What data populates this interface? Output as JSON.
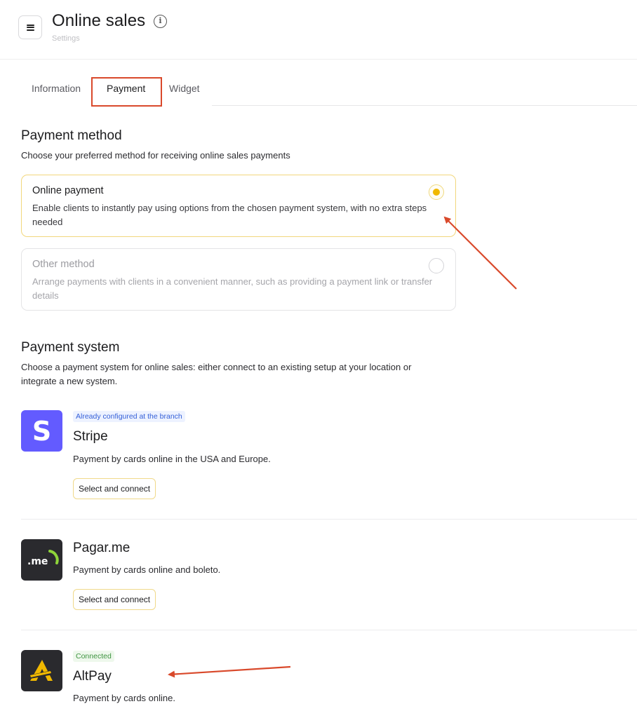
{
  "header": {
    "title": "Online sales",
    "subtitle": "Settings",
    "menu_icon": "menu-icon",
    "info_icon": "info-icon"
  },
  "tabs": [
    {
      "label": "Information",
      "active": false
    },
    {
      "label": "Payment",
      "active": true
    },
    {
      "label": "Widget",
      "active": false
    }
  ],
  "payment_method": {
    "heading": "Payment method",
    "description": "Choose your preferred method for receiving online sales payments",
    "options": [
      {
        "title": "Online payment",
        "description": "Enable clients to instantly pay using options from the chosen payment system, with no extra steps needed",
        "selected": true
      },
      {
        "title": "Other method",
        "description": "Arrange payments with clients in a convenient manner, such as providing a payment link or transfer details",
        "selected": false
      }
    ]
  },
  "payment_system": {
    "heading": "Payment system",
    "description": "Choose a payment system for online sales: either connect to an existing setup at your location or integrate a new system.",
    "providers": [
      {
        "name": "Stripe",
        "badge": "Already configured at the branch",
        "description": "Payment by cards online in the USA and Europe.",
        "button": "Select and connect",
        "logo_text": "S"
      },
      {
        "name": "Pagar.me",
        "badge": "",
        "description": "Payment by cards online and boleto.",
        "button": "Select and connect",
        "logo_text": ".me"
      },
      {
        "name": "AltPay",
        "badge": "Connected",
        "description": "Payment by cards online.",
        "button": ""
      }
    ]
  },
  "colors": {
    "accent": "#f0b800",
    "annotation": "#d9492b",
    "stripe_brand": "#635bff",
    "badge_blue": "#3560d8",
    "badge_green": "#3e9440"
  }
}
